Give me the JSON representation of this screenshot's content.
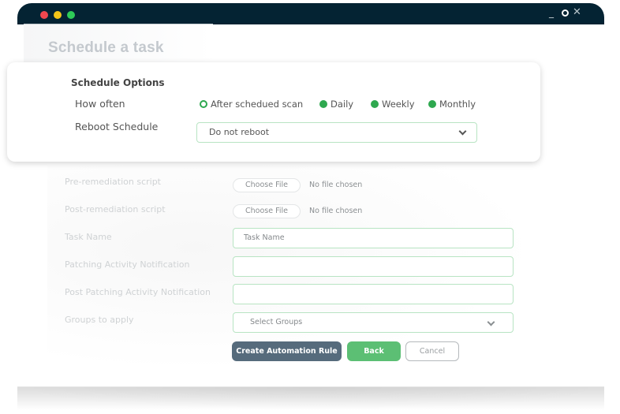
{
  "window": {
    "controls": {
      "minimize": "_",
      "close": "✕"
    }
  },
  "page": {
    "title": "Schedule a task"
  },
  "schedule_options": {
    "title": "Schedule Options",
    "how_often_label": "How often",
    "frequency_options": [
      {
        "label": "After schedued scan",
        "selected": false
      },
      {
        "label": "Daily",
        "selected": true
      },
      {
        "label": "Weekly",
        "selected": true
      },
      {
        "label": "Monthly",
        "selected": true
      }
    ],
    "reboot_label": "Reboot Schedule",
    "reboot_value": "Do not reboot"
  },
  "form": {
    "pre_script_label": "Pre-remediation script",
    "post_script_label": "Post-remediation script",
    "choose_file": "Choose File",
    "no_file": "No file chosen",
    "task_name_label": "Task Name",
    "task_name_placeholder": "Task Name",
    "patching_notification_label": "Patching Activity Notification",
    "post_patching_notification_label": "Post Patching Activity Notification",
    "groups_label": "Groups to apply",
    "groups_placeholder": "Select Groups"
  },
  "buttons": {
    "create": "Create Automation Rule",
    "back": "Back",
    "cancel": "Cancel"
  },
  "colors": {
    "titlebar": "#042333",
    "accent_green": "#5cbf74",
    "radio_green": "#2ea84f",
    "create_button": "#566b7c"
  }
}
